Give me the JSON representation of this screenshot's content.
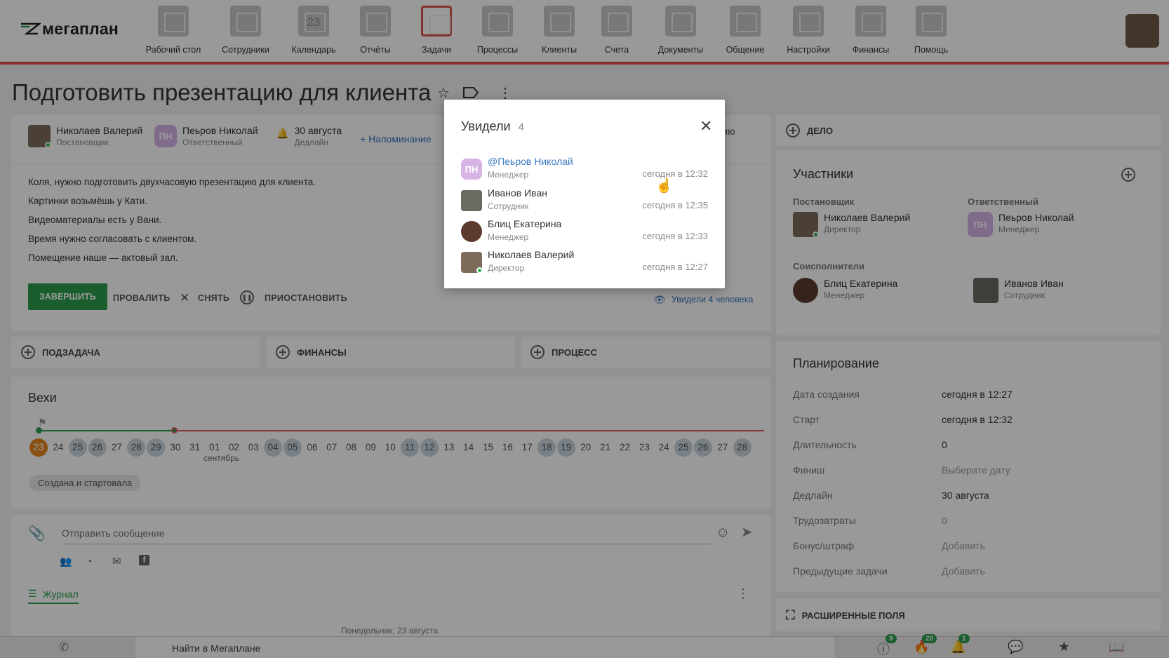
{
  "app": {
    "logo": "мегаплан"
  },
  "nav": [
    {
      "label": "Рабочий стол",
      "icon": "desktop-icon"
    },
    {
      "label": "Сотрудники",
      "icon": "employees-icon"
    },
    {
      "label": "Календарь",
      "icon": "calendar-icon",
      "badge": "23"
    },
    {
      "label": "Отчёты",
      "icon": "reports-icon"
    },
    {
      "label": "Задачи",
      "icon": "tasks-icon",
      "active": true
    },
    {
      "label": "Процессы",
      "icon": "processes-icon"
    },
    {
      "label": "Клиенты",
      "icon": "clients-icon"
    },
    {
      "label": "Счета",
      "icon": "invoices-icon"
    },
    {
      "label": "Документы",
      "icon": "documents-icon"
    },
    {
      "label": "Общение",
      "icon": "chat-icon"
    },
    {
      "label": "Настройки",
      "icon": "settings-icon"
    },
    {
      "label": "Финансы",
      "icon": "finance-icon"
    },
    {
      "label": "Помощь",
      "icon": "help-icon"
    }
  ],
  "task": {
    "title": "Подготовить презентацию для клиента",
    "author": {
      "name": "Николаев Валерий",
      "role": "Постановщик"
    },
    "responsible": {
      "initials": "ПН",
      "name": "Пеьров Николай",
      "role": "Ответственный"
    },
    "deadline": {
      "value": "30 августа",
      "label": "Дедлайн"
    },
    "reminder": "+ Напоминание",
    "cut_text": "нению",
    "description": [
      "Коля, нужно подготовить двухчасовую презентацию для клиента.",
      "Картинки возьмёшь у Кати.",
      "Видеоматериалы есть у Вани.",
      "Время нужно согласовать с клиентом.",
      "Помещение наше — актовый зал."
    ],
    "actions": {
      "complete": "ЗАВЕРШИТЬ",
      "fail": "ПРОВАЛИТЬ",
      "remove": "СНЯТЬ",
      "pause": "ПРИОСТАНОВИТЬ"
    },
    "seen_link": "Увидели 4 человека"
  },
  "sections": {
    "subtask": "ПОДЗАДАЧА",
    "finance": "ФИНАНСЫ",
    "process": "ПРОЦЕСС"
  },
  "timeline": {
    "title": "Вехи",
    "days": [
      "23",
      "24",
      "25",
      "26",
      "27",
      "28",
      "29",
      "30",
      "31",
      "01",
      "02",
      "03",
      "04",
      "05",
      "06",
      "07",
      "08",
      "09",
      "10",
      "11",
      "12",
      "13",
      "14",
      "15",
      "16",
      "17",
      "18",
      "19",
      "20",
      "21",
      "22",
      "23",
      "24",
      "25",
      "26",
      "27",
      "28"
    ],
    "weekend": [
      "28",
      "29",
      "04",
      "05",
      "11",
      "12",
      "18",
      "19",
      "25",
      "26"
    ],
    "month_label": "сентябрь",
    "status_chip": "Создана и стартовала"
  },
  "message": {
    "placeholder": "Отправить сообщение",
    "journal": "Журнал",
    "date_label": "Понедельник, 23 августа"
  },
  "right": {
    "delo": "ДЕЛО",
    "participants": {
      "title": "Участники",
      "author_label": "Постановщик",
      "author": {
        "name": "Николаев Валерий",
        "role": "Директор"
      },
      "responsible_label": "Ответственный",
      "responsible": {
        "initials": "ПН",
        "name": "Пеьров Николай",
        "role": "Менеджер"
      },
      "co_label": "Соисполнители",
      "co": [
        {
          "name": "Блиц Екатерина",
          "role": "Менеджер"
        },
        {
          "name": "Иванов Иван",
          "role": "Сотрудник"
        }
      ]
    },
    "planning": {
      "title": "Планирование",
      "rows": [
        {
          "label": "Дата создания",
          "value": "сегодня в 12:27"
        },
        {
          "label": "Старт",
          "value": "сегодня в 12:32"
        },
        {
          "label": "Длительность",
          "value": "0"
        },
        {
          "label": "Финиш",
          "value": "Выберите дату"
        },
        {
          "label": "Дедлайн",
          "value": "30 августа"
        },
        {
          "label": "Трудозатраты",
          "value": "0"
        },
        {
          "label": "Бонус/штраф",
          "value": "Добавить"
        },
        {
          "label": "Предыдущие задачи",
          "value": "Добавить"
        }
      ]
    },
    "extended": "РАСШИРЕННЫЕ ПОЛЯ"
  },
  "bottom": {
    "search": "Найти в Мегаплане",
    "badges": {
      "alerts": "9",
      "hot": "20",
      "notifications": "1"
    }
  },
  "modal": {
    "title": "Увидели",
    "count": "4",
    "viewers": [
      {
        "initials": "ПН",
        "name": "@Пеьров Николай",
        "role": "Менеджер",
        "time": "сегодня в 12:32"
      },
      {
        "name": "Иванов Иван",
        "role": "Сотрудник",
        "time": "сегодня в 12:35"
      },
      {
        "name": "Блиц Екатерина",
        "role": "Менеджер",
        "time": "сегодня в 12:33"
      },
      {
        "name": "Николаев Валерий",
        "role": "Директор",
        "time": "сегодня в 12:27"
      }
    ]
  },
  "colors": {
    "accent": "#d9534f",
    "green": "#2a9d4a",
    "link": "#3b78c2",
    "today": "#e6861d"
  }
}
